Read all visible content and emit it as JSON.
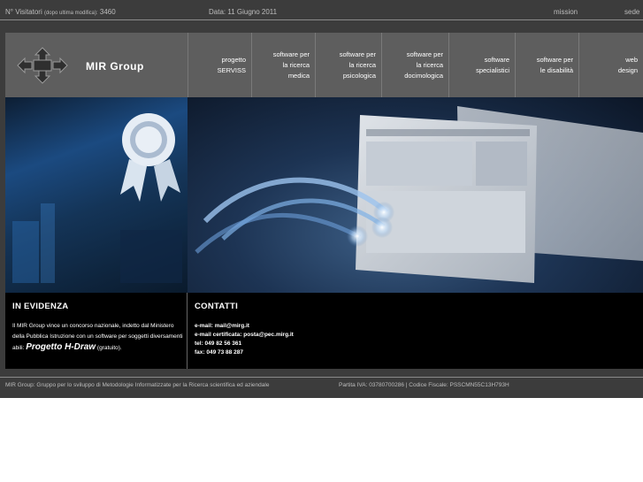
{
  "topbar": {
    "visitors_label": "N° Visitatori",
    "visitors_note": "(dopo ultima modifica):",
    "visitors_count": "3460",
    "date": "Data: 11 Giugno 2011",
    "links": [
      "mission",
      "sede"
    ]
  },
  "logo": {
    "brand": "MIR Group"
  },
  "nav": [
    {
      "label": "progetto\nSERVISS"
    },
    {
      "label": "software per\nla ricerca\nmedica"
    },
    {
      "label": "software per\nla ricerca\npsicologica"
    },
    {
      "label": "software per\nla ricerca\ndocimologica"
    },
    {
      "label": "software\nspecialistici"
    },
    {
      "label": "software per\nle disabilità"
    },
    {
      "label": "web\ndesign"
    }
  ],
  "news": {
    "title": "IN EVIDENZA",
    "text_before": "Il MIR Group vince un concorso nazionale, indetto dal Ministero della Pubblica Istruzione con un software per soggetti diversamenti abili:",
    "product": "Progetto H-Draw",
    "text_after": "(gratuito)."
  },
  "contacts": {
    "title": "CONTATTI",
    "email": "e-mail: mail@mirg.it",
    "pec": "e-mail certificata: posta@pec.mirg.it",
    "tel": "tel: 049 82 56 361",
    "fax": "fax: 049 73 88 287"
  },
  "footer": {
    "description": "MIR Group: Gruppo per lo sviluppo di Metodologie Informatizzate per la Ricerca scientifica ed aziendale",
    "fiscal": "Partita IVA: 03780700286 | Codice Fiscale: PSSCMN55C13H793H"
  },
  "colors": {
    "background": "#3c3c3c",
    "nav_background": "#5e5e5e",
    "panel_background": "#000000"
  }
}
